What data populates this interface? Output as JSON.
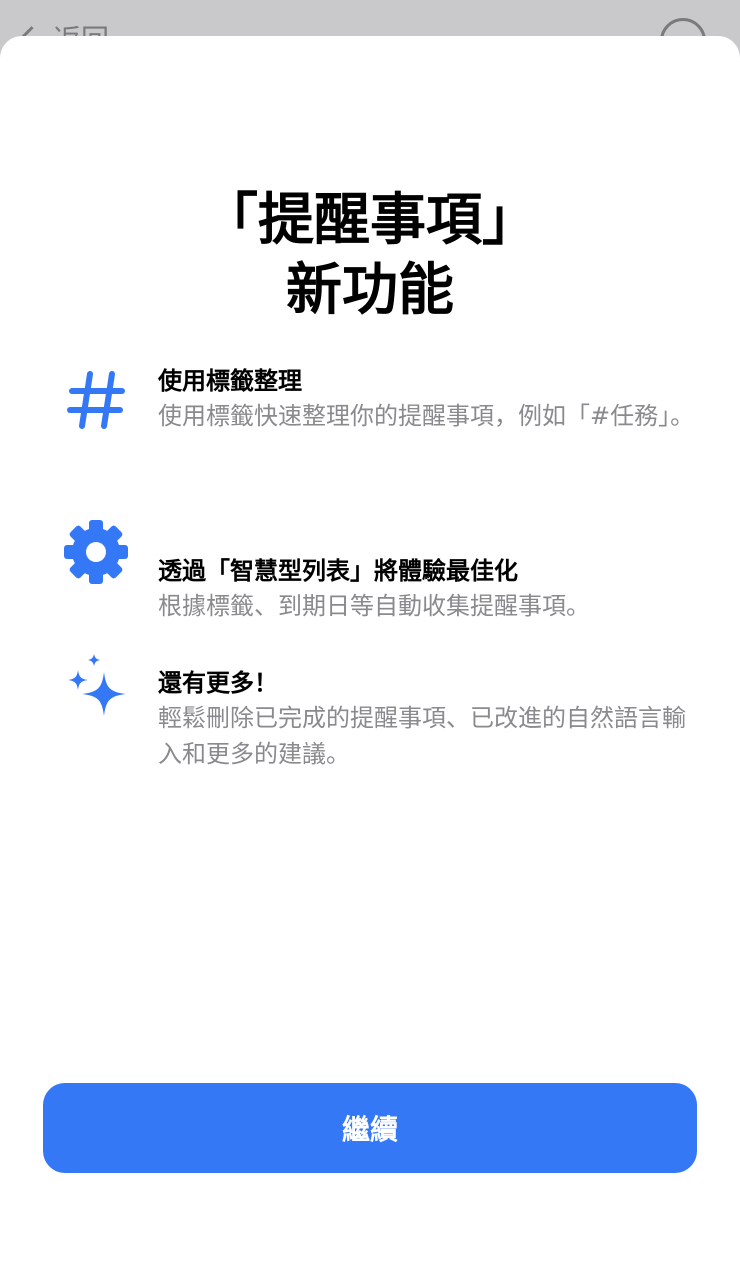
{
  "background": {
    "back_label": "返回"
  },
  "sheet": {
    "title_line1": "「提醒事項」",
    "title_line2": "新功能",
    "features": [
      {
        "icon": "hashtag-icon",
        "heading": "使用標籤整理",
        "description": "使用標籤快速整理你的提醒事項，例如「#任務」。"
      },
      {
        "icon": "gear-icon",
        "heading": "透過「智慧型列表」將體驗最佳化",
        "description": "根據標籤、到期日等自動收集提醒事項。"
      },
      {
        "icon": "sparkles-icon",
        "heading": "還有更多！",
        "description": "輕鬆刪除已完成的提醒事項、已改進的自然語言輸入和更多的建議。"
      }
    ],
    "continue_label": "繼續"
  },
  "colors": {
    "accent": "#3478f6",
    "secondary_text": "#8a8a8e"
  }
}
